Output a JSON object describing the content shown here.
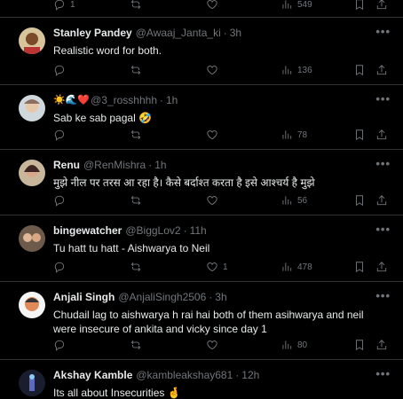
{
  "top_partial": {
    "reply_count": "1",
    "views": "549"
  },
  "tweets": [
    {
      "name": "Stanley Pandey",
      "handle": "@Awaaj_Janta_ki",
      "time": "3h",
      "text": "Realistic word for both.",
      "replies": "",
      "retweets": "",
      "likes": "",
      "views": "136"
    },
    {
      "name_emoji": "☀️🌊❤️",
      "handle": "@3_rosshhhh",
      "time": "1h",
      "text": "Sab ke sab pagal 🤣",
      "replies": "",
      "retweets": "",
      "likes": "",
      "views": "78"
    },
    {
      "name": "Renu",
      "handle": "@RenMishra",
      "time": "1h",
      "text": "मुझे नील पर तरस आ रहा है। कैसे बर्दाश्त करता है इसे आश्चर्य है मुझे",
      "replies": "",
      "retweets": "",
      "likes": "",
      "views": "56"
    },
    {
      "name": "bingewatcher",
      "handle": "@BiggLov2",
      "time": "11h",
      "text": "Tu hatt tu hatt - Aishwarya to Neil",
      "replies": "",
      "retweets": "",
      "likes": "1",
      "views": "478"
    },
    {
      "name": "Anjali Singh",
      "handle": "@AnjaliSingh2506",
      "time": "3h",
      "text": "Chudail lag to aishwarya h rai hai both of them asihwarya and neil were insecure of ankita and vicky since day 1",
      "replies": "",
      "retweets": "",
      "likes": "",
      "views": "80"
    },
    {
      "name": "Akshay Kamble",
      "handle": "@kambleakshay681",
      "time": "12h",
      "text": "Its all about Insecurities 🤞"
    }
  ],
  "separator": "·",
  "more_icon": "•••"
}
